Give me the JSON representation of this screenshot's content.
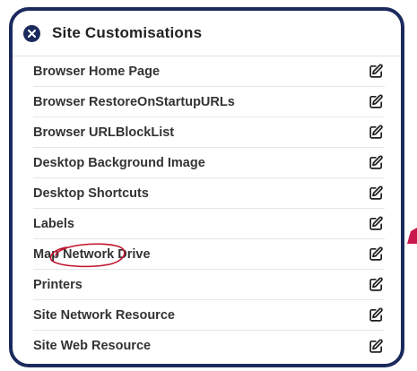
{
  "panel": {
    "title": "Site Customisations",
    "close_icon": "close-icon",
    "edit_icon": "edit-pencil-icon",
    "items": [
      {
        "label": "Browser Home Page"
      },
      {
        "label": "Browser RestoreOnStartupURLs"
      },
      {
        "label": "Browser URLBlockList"
      },
      {
        "label": "Desktop Background Image"
      },
      {
        "label": "Desktop Shortcuts"
      },
      {
        "label": "Labels"
      },
      {
        "label": "Map Network Drive"
      },
      {
        "label": "Printers"
      },
      {
        "label": "Site Network Resource"
      },
      {
        "label": "Site Web Resource"
      }
    ]
  },
  "annotation": {
    "highlighted_item": "Map Network Drive",
    "circle_color": "#c0132b",
    "pointer_color": "#c8174a"
  },
  "colors": {
    "border": "#1b2a5c",
    "close_button": "#1b2a5c",
    "text": "#333333"
  }
}
